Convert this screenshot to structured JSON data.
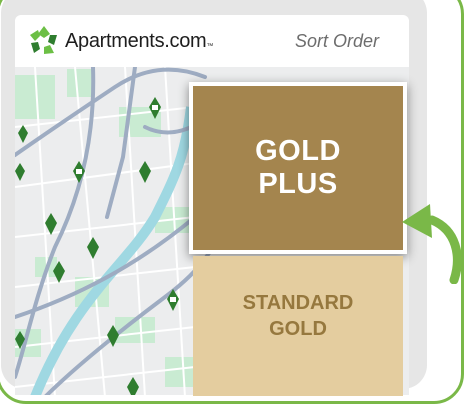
{
  "brand": {
    "name": "Apartments.com",
    "trademark": "™",
    "green": "#7ab848",
    "dark_green": "#2f7d2f"
  },
  "header": {
    "sort_label": "Sort Order"
  },
  "tiles": {
    "gold_plus": {
      "line1": "GOLD",
      "line2": "PLUS",
      "color": "#a4854e"
    },
    "standard_gold": {
      "line1": "STANDARD",
      "line2": "GOLD",
      "color": "#e4cd9f"
    }
  },
  "map": {
    "pin_color": "#2f7d2f",
    "road_color": "#9eacc2",
    "river_color": "#9fd8e2",
    "park_color": "#c9ebd2"
  },
  "arrow": {
    "color": "#7ab848",
    "icon": "curved-arrow-left-icon"
  }
}
